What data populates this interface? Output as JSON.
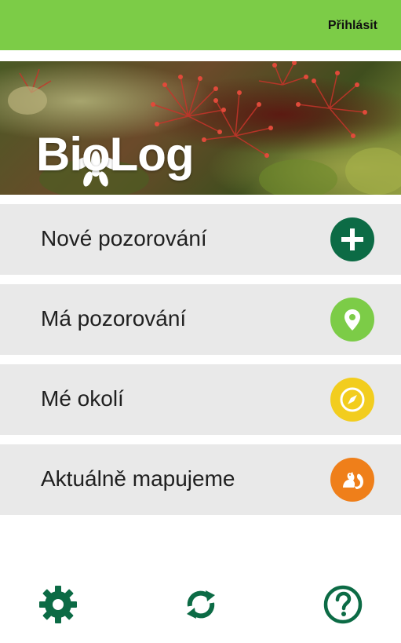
{
  "header": {
    "login_label": "Přihlásit",
    "color": "#7ccc47"
  },
  "hero": {
    "brand": "BioLog"
  },
  "menu": {
    "items": [
      {
        "label": "Nové pozorování",
        "icon": "plus-icon",
        "color": "#0c6b45"
      },
      {
        "label": "Má pozorování",
        "icon": "location-pin-icon",
        "color": "#7ccc47"
      },
      {
        "label": "Mé okolí",
        "icon": "compass-icon",
        "color": "#f2cd1e"
      },
      {
        "label": "Aktuálně mapujeme",
        "icon": "squirrel-icon",
        "color": "#ef7f1a"
      }
    ]
  },
  "footer": {
    "buttons": [
      {
        "icon": "gear-icon",
        "color": "#0c6b45"
      },
      {
        "icon": "refresh-icon",
        "color": "#0c6b45"
      },
      {
        "icon": "help-icon",
        "color": "#0c6b45"
      }
    ]
  }
}
